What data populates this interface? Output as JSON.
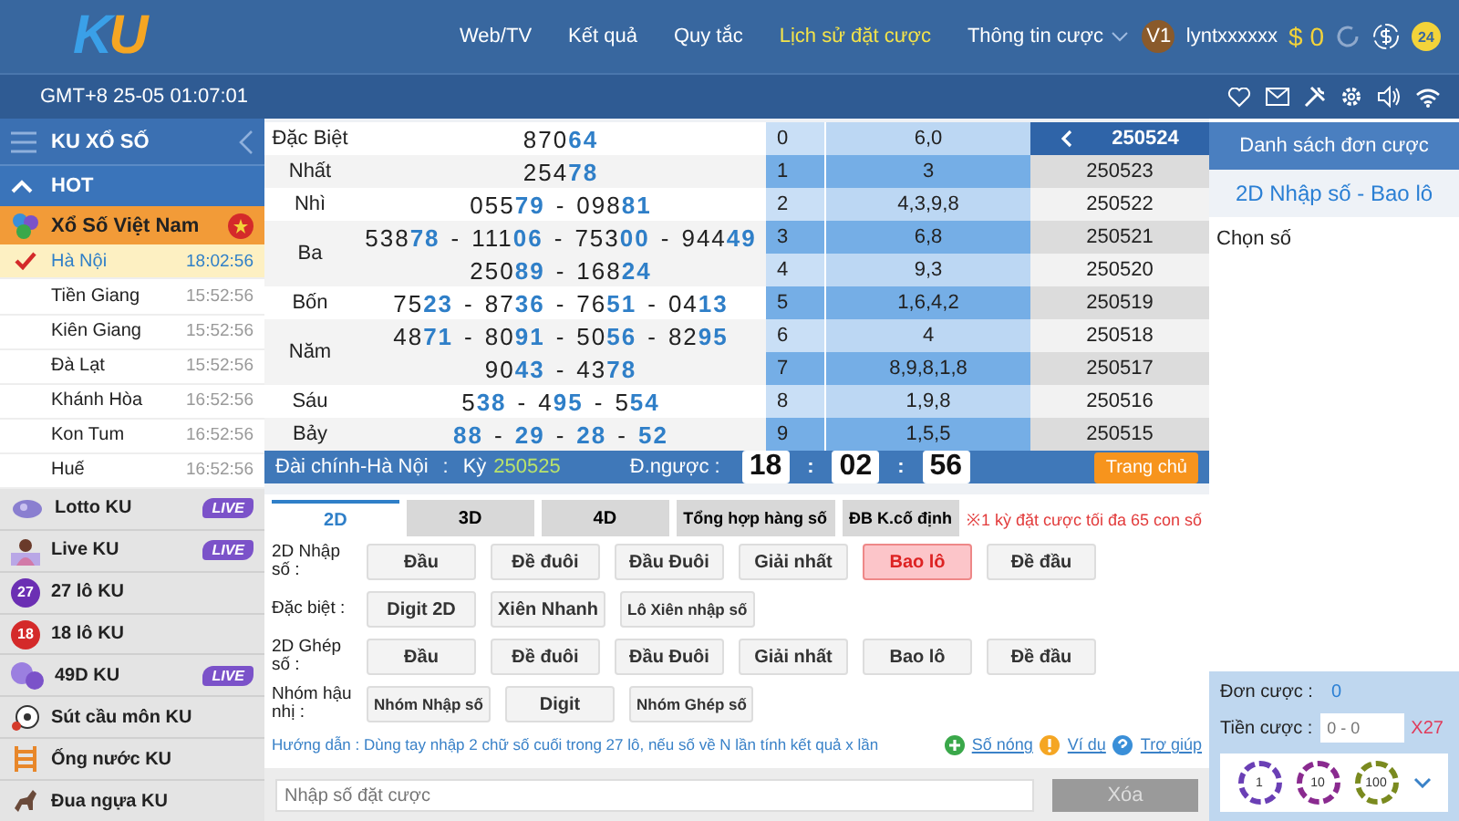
{
  "header": {
    "logo": {
      "first": "K",
      "second": "U"
    },
    "nav": [
      {
        "label": "Web/TV",
        "selected": false,
        "dropdown": false
      },
      {
        "label": "Kết quả",
        "selected": false,
        "dropdown": false
      },
      {
        "label": "Quy tắc",
        "selected": false,
        "dropdown": false
      },
      {
        "label": "Lịch sử đặt cược",
        "selected": true,
        "dropdown": false
      },
      {
        "label": "Thông tin cược",
        "selected": false,
        "dropdown": true
      }
    ],
    "level": "V1",
    "username": "lyntxxxxxx",
    "balance": "$ 0",
    "support_badge": "24"
  },
  "subbar": {
    "clock": "GMT+8 25-05 01:07:01"
  },
  "sidebar": {
    "title": "KU XỔ SỐ",
    "section": "HOT",
    "expanded": true,
    "group": {
      "label": "Xổ Số Việt Nam",
      "children": [
        {
          "label": "Hà Nội",
          "time": "18:02:56",
          "selected": true
        },
        {
          "label": "Tiền Giang",
          "time": "15:52:56",
          "selected": false
        },
        {
          "label": "Kiên Giang",
          "time": "15:52:56",
          "selected": false
        },
        {
          "label": "Đà Lạt",
          "time": "15:52:56",
          "selected": false
        },
        {
          "label": "Khánh Hòa",
          "time": "16:52:56",
          "selected": false
        },
        {
          "label": "Kon Tum",
          "time": "16:52:56",
          "selected": false
        },
        {
          "label": "Huế",
          "time": "16:52:56",
          "selected": false
        }
      ]
    },
    "games": [
      {
        "label": "Lotto KU",
        "kind": "lotto",
        "live": "LIVE"
      },
      {
        "label": "Live KU",
        "kind": "live",
        "live": "LIVE"
      },
      {
        "label": "27 lô KU",
        "kind": "ball",
        "icon_label": "27",
        "color": "#6b2fb3"
      },
      {
        "label": "18 lô KU",
        "kind": "ball",
        "icon_label": "18",
        "color": "#d42a2a"
      },
      {
        "label": "49D KU",
        "kind": "cluster",
        "live": "LIVE"
      },
      {
        "label": "Sút cầu môn KU",
        "kind": "soccer"
      },
      {
        "label": "Ống nước KU",
        "kind": "ladder"
      },
      {
        "label": "Đua ngựa KU",
        "kind": "horse"
      }
    ]
  },
  "results": {
    "separator": "-",
    "prizes": [
      {
        "label": "Đặc Biệt",
        "lines": [
          [
            {
              "head": "870",
              "tail": "64"
            }
          ]
        ]
      },
      {
        "label": "Nhất",
        "lines": [
          [
            {
              "head": "254",
              "tail": "78"
            }
          ]
        ]
      },
      {
        "label": "Nhì",
        "lines": [
          [
            {
              "head": "055",
              "tail": "79"
            },
            {
              "head": "098",
              "tail": "81"
            }
          ]
        ]
      },
      {
        "label": "Ba",
        "lines": [
          [
            {
              "head": "538",
              "tail": "78"
            },
            {
              "head": "111",
              "tail": "06"
            },
            {
              "head": "753",
              "tail": "00"
            },
            {
              "head": "944",
              "tail": "49"
            }
          ],
          [
            {
              "head": "250",
              "tail": "89"
            },
            {
              "head": "168",
              "tail": "24"
            }
          ]
        ]
      },
      {
        "label": "Bốn",
        "lines": [
          [
            {
              "head": "75",
              "tail": "23"
            },
            {
              "head": "87",
              "tail": "36"
            },
            {
              "head": "76",
              "tail": "51"
            },
            {
              "head": "04",
              "tail": "13"
            }
          ]
        ]
      },
      {
        "label": "Năm",
        "lines": [
          [
            {
              "head": "48",
              "tail": "71"
            },
            {
              "head": "80",
              "tail": "91"
            },
            {
              "head": "50",
              "tail": "56"
            },
            {
              "head": "82",
              "tail": "95"
            }
          ],
          [
            {
              "head": "90",
              "tail": "43"
            },
            {
              "head": "43",
              "tail": "78"
            }
          ]
        ]
      },
      {
        "label": "Sáu",
        "lines": [
          [
            {
              "head": "5",
              "tail": "38"
            },
            {
              "head": "4",
              "tail": "95"
            },
            {
              "head": "5",
              "tail": "54"
            }
          ]
        ]
      },
      {
        "label": "Bảy",
        "lines": [
          [
            {
              "tail": "88"
            },
            {
              "tail": "29"
            },
            {
              "tail": "28"
            },
            {
              "tail": "52"
            }
          ]
        ]
      }
    ]
  },
  "digits": [
    {
      "digit": "0",
      "values": "6,0"
    },
    {
      "digit": "1",
      "values": "3"
    },
    {
      "digit": "2",
      "values": "4,3,9,8"
    },
    {
      "digit": "3",
      "values": "6,8"
    },
    {
      "digit": "4",
      "values": "9,3"
    },
    {
      "digit": "5",
      "values": "1,6,4,2"
    },
    {
      "digit": "6",
      "values": "4"
    },
    {
      "digit": "7",
      "values": "8,9,8,1,8"
    },
    {
      "digit": "8",
      "values": "1,9,8"
    },
    {
      "digit": "9",
      "values": "1,5,5"
    }
  ],
  "history": [
    {
      "label": "250524",
      "selected": true
    },
    {
      "label": "250523",
      "selected": false
    },
    {
      "label": "250522",
      "selected": false
    },
    {
      "label": "250521",
      "selected": false
    },
    {
      "label": "250520",
      "selected": false
    },
    {
      "label": "250519",
      "selected": false
    },
    {
      "label": "250518",
      "selected": false
    },
    {
      "label": "250517",
      "selected": false
    },
    {
      "label": "250516",
      "selected": false
    },
    {
      "label": "250515",
      "selected": false
    }
  ],
  "draw_bar": {
    "station": "Đài chính-Hà Nội",
    "colon": ":",
    "period_label": "Kỳ",
    "period": "250525",
    "countdown_label": "Đ.ngược :",
    "countdown": [
      "18",
      "02",
      "56"
    ],
    "countdown_separator": ":",
    "home_button": "Trang chủ"
  },
  "bet_tabs": [
    {
      "label": "2D",
      "selected": true
    },
    {
      "label": "3D",
      "selected": false
    },
    {
      "label": "4D",
      "selected": false
    },
    {
      "label": "Tổng hợp hàng số",
      "selected": false
    },
    {
      "label": "ĐB K.cố định",
      "selected": false
    }
  ],
  "limit_note": "※1 kỳ đặt cược tối đa 65 con số",
  "bet_rows": [
    {
      "label": "2D Nhập số :",
      "options": [
        {
          "label": "Đầu",
          "selected": false
        },
        {
          "label": "Đề đuôi",
          "selected": false
        },
        {
          "label": "Đầu Đuôi",
          "selected": false
        },
        {
          "label": "Giải nhất",
          "selected": false
        },
        {
          "label": "Bao lô",
          "selected": true
        },
        {
          "label": "Đề đầu",
          "selected": false
        }
      ]
    },
    {
      "label": "Đặc biệt :",
      "options": [
        {
          "label": "Digit 2D",
          "selected": false
        },
        {
          "label": "Xiên Nhanh",
          "selected": false
        },
        {
          "label": "Lô Xiên nhập số",
          "selected": false
        }
      ]
    },
    {
      "label": "2D Ghép số :",
      "options": [
        {
          "label": "Đầu",
          "selected": false
        },
        {
          "label": "Đề đuôi",
          "selected": false
        },
        {
          "label": "Đầu Đuôi",
          "selected": false
        },
        {
          "label": "Giải nhất",
          "selected": false
        },
        {
          "label": "Bao lô",
          "selected": false
        },
        {
          "label": "Đề đầu",
          "selected": false
        }
      ]
    },
    {
      "label": "Nhóm hậu nhị :",
      "options": [
        {
          "label": "Nhóm Nhập số",
          "selected": false
        },
        {
          "label": "Digit",
          "selected": false
        },
        {
          "label": "Nhóm Ghép số",
          "selected": false
        }
      ]
    }
  ],
  "guide": "Hướng dẫn : Dùng tay nhập 2 chữ số cuối trong 27 lô, nếu số về N lần tính kết quả x lần",
  "links": [
    {
      "label": "Số nóng",
      "kind": "plus"
    },
    {
      "label": "Ví dụ",
      "kind": "warning"
    },
    {
      "label": "Trợ giúp",
      "kind": "help"
    }
  ],
  "number_input": {
    "placeholder": "Nhập số đặt cược"
  },
  "clear_button": {
    "label": "Xóa",
    "disabled": true
  },
  "bet_list": {
    "title": "Danh sách đơn cược",
    "bet_type": "2D Nhập số - Bao lô",
    "prompt": "Chọn số",
    "order_label": "Đơn cược :",
    "order_count": "0",
    "amount_label": "Tiền cược :",
    "amount_placeholder": "0 - 0",
    "multiplier": "X27",
    "chips": [
      {
        "label": "1",
        "color": "#6a3fb5"
      },
      {
        "label": "10",
        "color": "#8a2a8f"
      },
      {
        "label": "100",
        "color": "#7a8a1f"
      }
    ]
  }
}
